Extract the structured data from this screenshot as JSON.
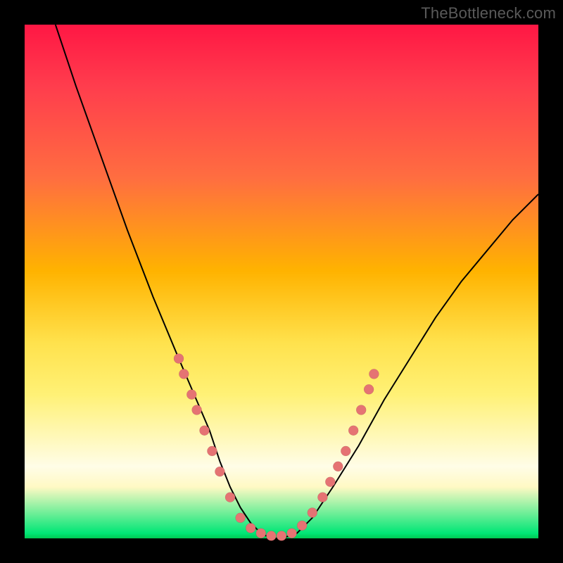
{
  "watermark": "TheBottleneck.com",
  "colors": {
    "frame": "#000000",
    "gradient_top": "#ff1744",
    "gradient_mid": "#ffe24d",
    "gradient_bottom": "#00c853",
    "curve": "#000000",
    "marker": "#e57373"
  },
  "chart_data": {
    "type": "line",
    "title": "",
    "xlabel": "",
    "ylabel": "",
    "xlim": [
      0,
      100
    ],
    "ylim": [
      0,
      100
    ],
    "grid": false,
    "legend": false,
    "series": [
      {
        "name": "bottleneck-curve",
        "x": [
          6,
          10,
          15,
          20,
          25,
          30,
          33,
          36,
          38,
          40,
          42,
          44,
          46,
          48,
          50,
          53,
          56,
          60,
          65,
          70,
          75,
          80,
          85,
          90,
          95,
          100
        ],
        "y": [
          100,
          88,
          74,
          60,
          47,
          35,
          28,
          21,
          15,
          10,
          6,
          3,
          1,
          0,
          0,
          1,
          4,
          10,
          18,
          27,
          35,
          43,
          50,
          56,
          62,
          67
        ]
      }
    ],
    "markers": {
      "name": "highlight-points",
      "points": [
        {
          "x": 30,
          "y": 35
        },
        {
          "x": 31,
          "y": 32
        },
        {
          "x": 32.5,
          "y": 28
        },
        {
          "x": 33.5,
          "y": 25
        },
        {
          "x": 35,
          "y": 21
        },
        {
          "x": 36.5,
          "y": 17
        },
        {
          "x": 38,
          "y": 13
        },
        {
          "x": 40,
          "y": 8
        },
        {
          "x": 42,
          "y": 4
        },
        {
          "x": 44,
          "y": 2
        },
        {
          "x": 46,
          "y": 1
        },
        {
          "x": 48,
          "y": 0.5
        },
        {
          "x": 50,
          "y": 0.5
        },
        {
          "x": 52,
          "y": 1
        },
        {
          "x": 54,
          "y": 2.5
        },
        {
          "x": 56,
          "y": 5
        },
        {
          "x": 58,
          "y": 8
        },
        {
          "x": 59.5,
          "y": 11
        },
        {
          "x": 61,
          "y": 14
        },
        {
          "x": 62.5,
          "y": 17
        },
        {
          "x": 64,
          "y": 21
        },
        {
          "x": 65.5,
          "y": 25
        },
        {
          "x": 67,
          "y": 29
        },
        {
          "x": 68,
          "y": 32
        }
      ]
    }
  }
}
